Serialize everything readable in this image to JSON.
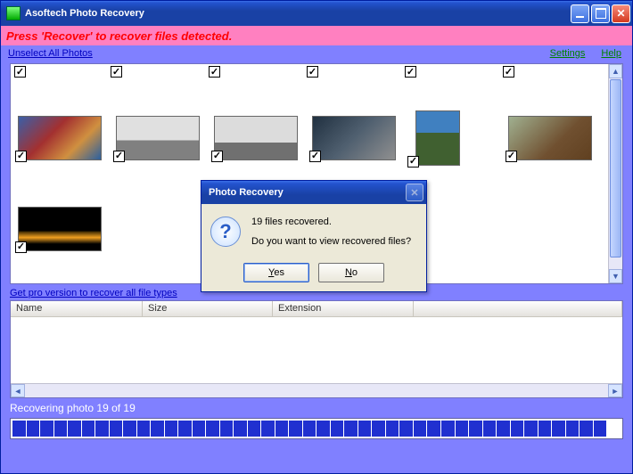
{
  "titlebar": {
    "title": "Asoftech Photo Recovery"
  },
  "header": {
    "press": "Press 'Recover' to recover files detected."
  },
  "links": {
    "unselect": "Unselect All Photos",
    "settings": "Settings",
    "help": "Help"
  },
  "proLink": "Get pro version to recover all file types",
  "table": {
    "col1": "Name",
    "col2": "Size",
    "col3": "Extension"
  },
  "status": "Recovering photo 19 of 19",
  "progress": {
    "segments": 44,
    "filled": 43
  },
  "dialog": {
    "title": "Photo Recovery",
    "line1": "19 files recovered.",
    "line2": "Do you want to view recovered files?",
    "yes": "Yes",
    "no": "No"
  },
  "thumbs": {
    "t1": "linear-gradient(135deg,#3a5fa8,#a33030 40%,#d09040 70%,#2a60a0)",
    "t2": "linear-gradient(180deg,#e0e0e0 55%,#808080 55%)",
    "t3": "linear-gradient(180deg,#dcdcdc 60%,#707070 60%)",
    "t4": "linear-gradient(135deg,#203040,#506070 50%,#909090)",
    "t5": "linear-gradient(180deg,#4080c0 40%,#406030 40%)",
    "t6": "linear-gradient(135deg,#a0b090,#705030 60%,#604020)",
    "t7": "linear-gradient(180deg,#000 55%,#302000 55%,#f0a020 70%,#000 85%)"
  }
}
